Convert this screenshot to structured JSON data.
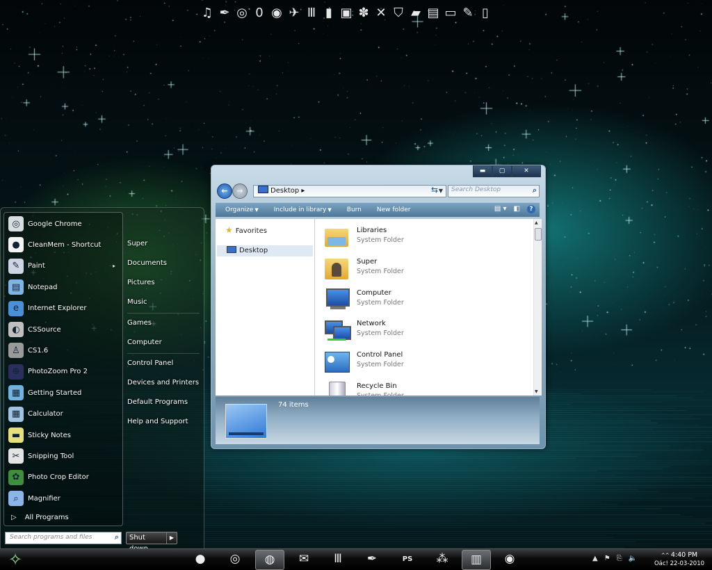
{
  "top_dock": {
    "icons": [
      "music-note-icon",
      "brush-icon",
      "browser-logo-icon",
      "zero-icon",
      "eye-icon",
      "bird-icon",
      "m-logo-icon",
      "glass-icon",
      "ipod-icon",
      "gear-flower-icon",
      "close-x-icon",
      "shield-icon",
      "folder-icon",
      "chip-icon",
      "monitor-icon",
      "wrench-icon",
      "bin-icon"
    ],
    "glyphs": [
      "♫",
      "✒",
      "◎",
      "0",
      "◉",
      "✈",
      "Ⅲ",
      "▮",
      "▣",
      "✽",
      "✕",
      "⛉",
      "▰",
      "▤",
      "▭",
      "✎",
      "▯"
    ]
  },
  "start_menu": {
    "programs": [
      {
        "label": "Google Chrome",
        "glyph": "◎",
        "color": "#d8dde2",
        "has_arrow": false
      },
      {
        "label": "CleanMem - Shortcut",
        "glyph": "●",
        "color": "#f4f4f4",
        "has_arrow": false
      },
      {
        "label": "Paint",
        "glyph": "✎",
        "color": "#cfd4e4",
        "has_arrow": true
      },
      {
        "label": "Notepad",
        "glyph": "▤",
        "color": "#7fb4e6",
        "has_arrow": false
      },
      {
        "label": "Internet Explorer",
        "glyph": "e",
        "color": "#4a90d8",
        "has_arrow": false
      },
      {
        "label": "CSSource",
        "glyph": "◐",
        "color": "#bfbfbf",
        "has_arrow": false
      },
      {
        "label": "CS1.6",
        "glyph": "♙",
        "color": "#9a9a9a",
        "has_arrow": false
      },
      {
        "label": "PhotoZoom Pro 2",
        "glyph": "⊕",
        "color": "#2b2f5c",
        "has_arrow": false
      },
      {
        "label": "Getting Started",
        "glyph": "▦",
        "color": "#6fb3e0",
        "has_arrow": false
      },
      {
        "label": "Calculator",
        "glyph": "▦",
        "color": "#9fc3e0",
        "has_arrow": false
      },
      {
        "label": "Sticky Notes",
        "glyph": "▬",
        "color": "#e6e07a",
        "has_arrow": false
      },
      {
        "label": "Snipping Tool",
        "glyph": "✂",
        "color": "#e4e4e4",
        "has_arrow": false
      },
      {
        "label": "Photo Crop Editor",
        "glyph": "✿",
        "color": "#3d8f3d",
        "has_arrow": false
      },
      {
        "label": "Magnifier",
        "glyph": "⌕",
        "color": "#8bb4e8",
        "has_arrow": false
      }
    ],
    "all_programs": "All Programs",
    "places": [
      "Super",
      "Documents",
      "Pictures",
      "Music",
      "Games",
      "Computer",
      "Control Panel",
      "Devices and Printers",
      "Default Programs",
      "Help and Support"
    ],
    "search_placeholder": "Search programs and files",
    "shutdown_label": "Shut down"
  },
  "explorer": {
    "address": "Desktop",
    "search_placeholder": "Search Desktop",
    "commands": [
      "Organize",
      "Include in library",
      "Burn",
      "New folder"
    ],
    "nav": {
      "favorites": "Favorites",
      "desktop": "Desktop"
    },
    "items": [
      {
        "name": "Libraries",
        "type": "System Folder",
        "icon": "libraries-icon"
      },
      {
        "name": "Super",
        "type": "System Folder",
        "icon": "user-folder-icon"
      },
      {
        "name": "Computer",
        "type": "System Folder",
        "icon": "computer-icon"
      },
      {
        "name": "Network",
        "type": "System Folder",
        "icon": "network-icon"
      },
      {
        "name": "Control Panel",
        "type": "System Folder",
        "icon": "control-panel-icon"
      },
      {
        "name": "Recycle Bin",
        "type": "System Folder",
        "icon": "recycle-bin-icon"
      }
    ],
    "item_count": "74 items"
  },
  "taskbar": {
    "buttons": [
      {
        "name": "cleanmem-icon",
        "glyph": "●",
        "active": false
      },
      {
        "name": "chrome-icon",
        "glyph": "◎",
        "active": false
      },
      {
        "name": "firefox-icon",
        "glyph": "◍",
        "active": true
      },
      {
        "name": "mail-icon",
        "glyph": "✉",
        "active": false
      },
      {
        "name": "m-logo-icon",
        "glyph": "Ⅲ",
        "active": false
      },
      {
        "name": "paint-brush-icon",
        "glyph": "✒",
        "active": false
      },
      {
        "name": "photoshop-icon",
        "glyph": "PS",
        "active": false
      },
      {
        "name": "network-nodes-icon",
        "glyph": "⁂",
        "active": false
      },
      {
        "name": "explorer-icon",
        "glyph": "▥",
        "active": true
      },
      {
        "name": "eye-icon",
        "glyph": "◉",
        "active": false
      }
    ],
    "time": "4:40 PM",
    "date": "Oác! 22-03-2010"
  }
}
